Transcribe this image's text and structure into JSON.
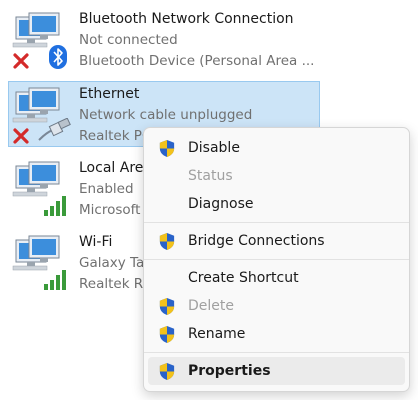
{
  "connections": [
    {
      "name": "Bluetooth Network Connection",
      "status": "Not connected",
      "device": "Bluetooth Device (Personal Area ...",
      "badge_icon": "red-x-icon",
      "overlay_icon": "bluetooth-icon"
    },
    {
      "name": "Ethernet",
      "status": "Network cable unplugged",
      "device": "Realtek PC",
      "badge_icon": "red-x-icon",
      "overlay_icon": "network-cable-icon",
      "selected": true
    },
    {
      "name": "Local Area",
      "status": "Enabled",
      "device": "Microsoft",
      "badge_icon": "signal-bars-icon"
    },
    {
      "name": "Wi-Fi",
      "status": "Galaxy Ta",
      "device": "Realtek R",
      "badge_icon": "signal-bars-icon"
    }
  ],
  "context_menu": {
    "items": [
      {
        "label": "Disable",
        "shield": true
      },
      {
        "label": "Status",
        "disabled": true
      },
      {
        "label": "Diagnose"
      },
      {
        "label": "Bridge Connections",
        "shield": true
      },
      {
        "label": "Create Shortcut"
      },
      {
        "label": "Delete",
        "disabled": true,
        "shield": true
      },
      {
        "label": "Rename",
        "shield": true
      },
      {
        "label": "Properties",
        "shield": true,
        "bold": true,
        "highlighted": true
      }
    ]
  },
  "colors": {
    "selection_bg": "#cce4f7",
    "selection_border": "#99c9ef",
    "secondary_text": "#707070",
    "disabled_text": "#a0a0a0",
    "error_red": "#d42a2a",
    "bluetooth_blue": "#1f6fe0",
    "signal_green": "#3a9a3a",
    "shield_blue": "#2a63c9",
    "shield_yellow": "#f3c21b"
  }
}
